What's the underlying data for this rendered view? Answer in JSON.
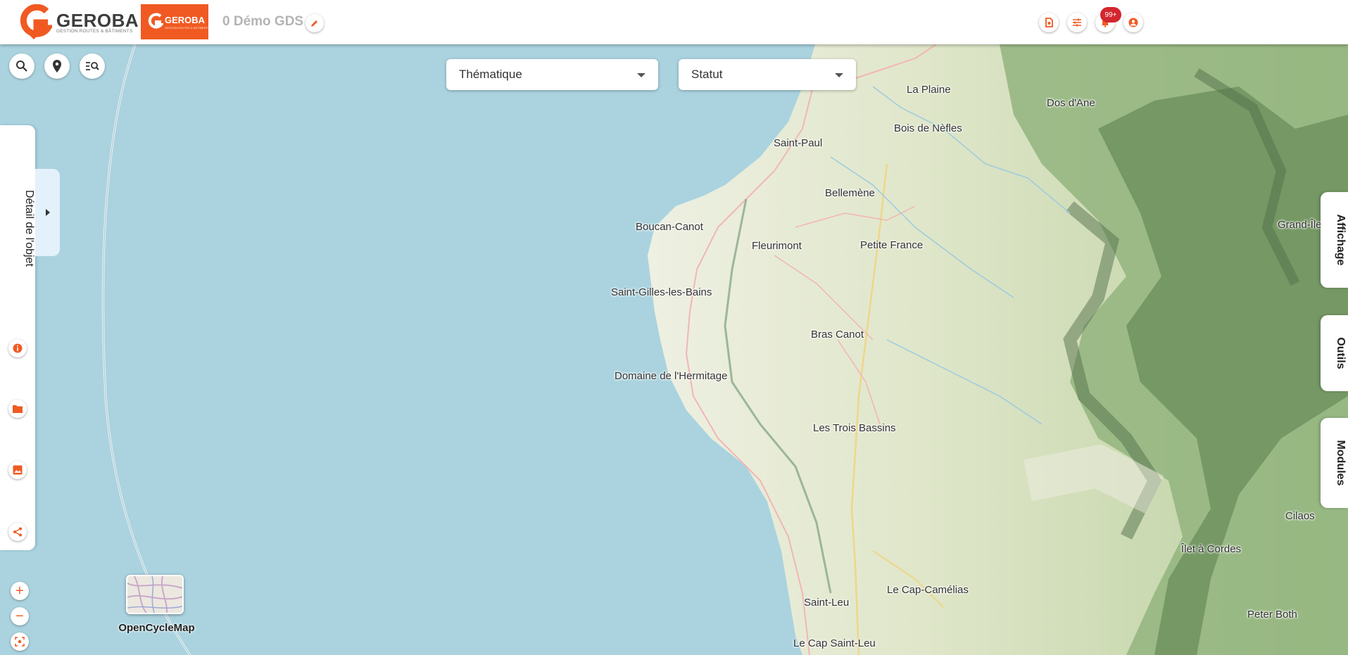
{
  "header": {
    "logo_text": "GEROBA",
    "logo_subtitle": "GESTION ROUTES & BÂTIMENTS",
    "secondary_logo_text": "GEROBA",
    "project_title": "0 Démo GDS",
    "notification_badge": "99+",
    "icons": [
      "document-icon",
      "filter-settings-icon",
      "bell-icon",
      "user-icon"
    ]
  },
  "map_tools": {
    "icons": [
      "search-icon",
      "location-pin-icon",
      "search-list-icon"
    ]
  },
  "filters": {
    "thematique": "Thématique",
    "statut": "Statut"
  },
  "left_panel": {
    "title": "Détail de l'objet",
    "icons": [
      "info-icon",
      "folder-icon",
      "image-icon",
      "share-icon"
    ]
  },
  "zoom": {
    "in": "+",
    "out": "−"
  },
  "basemap": {
    "label": "OpenCycleMap"
  },
  "right_tabs": [
    "Affichage",
    "Outils",
    "Modules"
  ],
  "places": [
    "La Plaine",
    "Dos d'Ane",
    "Bois de Nèfles",
    "Saint-Paul",
    "Bellemène",
    "Boucan-Canot",
    "Fleurimont",
    "Petite France",
    "Grand-Îlet",
    "Saint-Gilles-les-Bains",
    "Bras Canot",
    "Domaine de l'Hermitage",
    "Les Trois Bassins",
    "Cilaos",
    "Îlet à Cordes",
    "Le Cap-Camélias",
    "Saint-Leu",
    "Peter Both",
    "Le Cap Saint-Leu"
  ],
  "colors": {
    "accent": "#f05a22",
    "sea": "#aad3df",
    "land": "#e4e8d4",
    "badge": "#d3262e"
  }
}
